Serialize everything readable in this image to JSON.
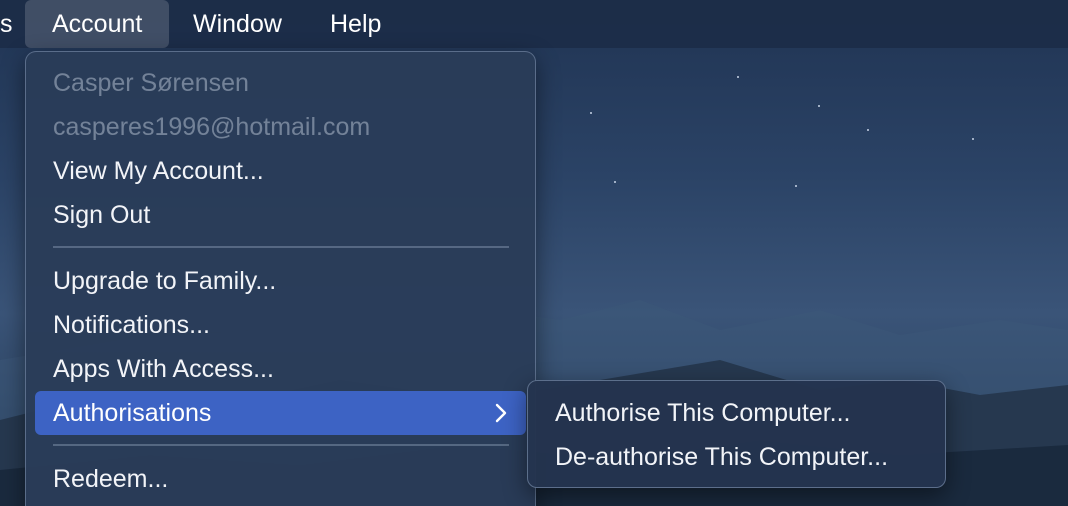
{
  "menubar": {
    "items": [
      {
        "label": "s"
      },
      {
        "label": "Account"
      },
      {
        "label": "Window"
      },
      {
        "label": "Help"
      }
    ]
  },
  "account_menu": {
    "user_name": "Casper Sørensen",
    "user_email": "casperes1996@hotmail.com",
    "items": [
      {
        "label": "View My Account..."
      },
      {
        "label": "Sign Out"
      },
      {
        "label": "Upgrade to Family..."
      },
      {
        "label": "Notifications..."
      },
      {
        "label": "Apps With Access..."
      },
      {
        "label": "Authorisations"
      },
      {
        "label": "Redeem..."
      }
    ]
  },
  "authorisations_submenu": {
    "items": [
      {
        "label": "Authorise This Computer..."
      },
      {
        "label": "De-authorise This Computer..."
      }
    ]
  },
  "colors": {
    "highlight": "#3d63c4",
    "menu_background": "#2a3c58",
    "menubar_background": "#1c2c48"
  },
  "icons": {
    "submenu_indicator": "chevron-right-icon"
  }
}
